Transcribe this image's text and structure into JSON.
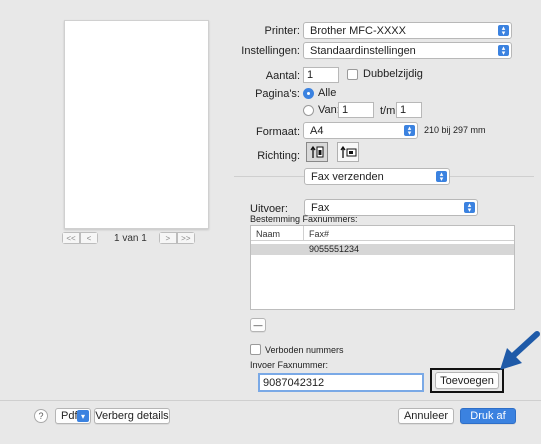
{
  "preview": {
    "page_indicator": "1 van 1",
    "nav_first": "<<",
    "nav_prev": "<",
    "nav_next": ">",
    "nav_last": ">>"
  },
  "printer": {
    "label": "Printer:",
    "value": "Brother MFC-XXXX"
  },
  "settings": {
    "label": "Instellingen:",
    "value": "Standaardinstellingen"
  },
  "copies": {
    "label": "Aantal:",
    "value": "1",
    "duplex_label": "Dubbelzijdig",
    "duplex_checked": false
  },
  "pages": {
    "label": "Pagina's:",
    "all_label": "Alle",
    "from_label": "Van:",
    "from_value": "1",
    "to_label": "t/m:",
    "to_value": "1",
    "selected": "Alle"
  },
  "format": {
    "label": "Formaat:",
    "value": "A4",
    "size_text": "210 bij 297 mm"
  },
  "orientation": {
    "label": "Richting:",
    "selected": "portrait"
  },
  "section_menu": {
    "value": "Fax verzenden"
  },
  "output": {
    "label": "Uitvoer:",
    "value": "Fax"
  },
  "destinations": {
    "label": "Bestemming Faxnummers:",
    "columns": [
      "Naam",
      "Fax#"
    ],
    "rows": [
      {
        "name": "",
        "fax": "9055551234"
      }
    ],
    "remove_button": "—"
  },
  "blocked": {
    "label": "Verboden nummers",
    "checked": false
  },
  "fax_input": {
    "label": "Invoer Faxnummer:",
    "value": "9087042312"
  },
  "add_button": "Toevoegen",
  "footer": {
    "help_label": "?",
    "pdf_label": "Pdf",
    "hide_details": "Verberg details",
    "cancel": "Annuleer",
    "print": "Druk af"
  },
  "colors": {
    "accent": "#3b82e0",
    "callout_arrow": "#1f5aa8",
    "highlight_box": "#111111"
  }
}
